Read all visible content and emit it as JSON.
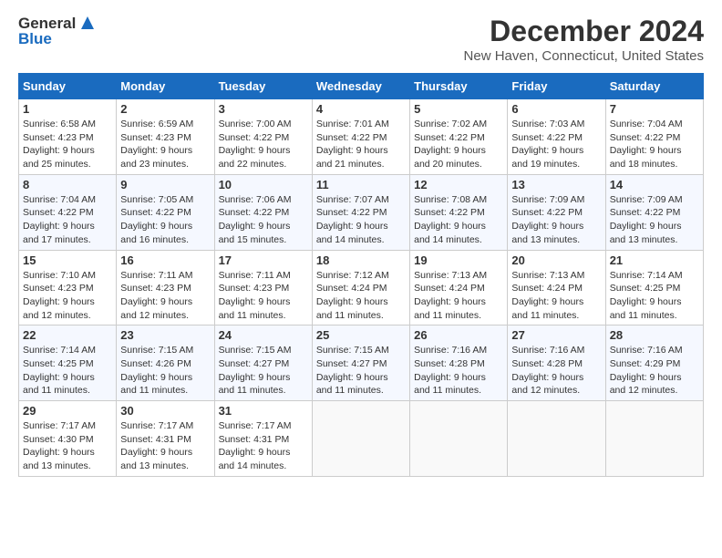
{
  "header": {
    "logo_line1": "General",
    "logo_line2": "Blue",
    "title": "December 2024",
    "subtitle": "New Haven, Connecticut, United States"
  },
  "weekdays": [
    "Sunday",
    "Monday",
    "Tuesday",
    "Wednesday",
    "Thursday",
    "Friday",
    "Saturday"
  ],
  "weeks": [
    [
      {
        "day": "1",
        "sunrise": "6:58 AM",
        "sunset": "4:23 PM",
        "daylight": "9 hours and 25 minutes."
      },
      {
        "day": "2",
        "sunrise": "6:59 AM",
        "sunset": "4:23 PM",
        "daylight": "9 hours and 23 minutes."
      },
      {
        "day": "3",
        "sunrise": "7:00 AM",
        "sunset": "4:22 PM",
        "daylight": "9 hours and 22 minutes."
      },
      {
        "day": "4",
        "sunrise": "7:01 AM",
        "sunset": "4:22 PM",
        "daylight": "9 hours and 21 minutes."
      },
      {
        "day": "5",
        "sunrise": "7:02 AM",
        "sunset": "4:22 PM",
        "daylight": "9 hours and 20 minutes."
      },
      {
        "day": "6",
        "sunrise": "7:03 AM",
        "sunset": "4:22 PM",
        "daylight": "9 hours and 19 minutes."
      },
      {
        "day": "7",
        "sunrise": "7:04 AM",
        "sunset": "4:22 PM",
        "daylight": "9 hours and 18 minutes."
      }
    ],
    [
      {
        "day": "8",
        "sunrise": "7:04 AM",
        "sunset": "4:22 PM",
        "daylight": "9 hours and 17 minutes."
      },
      {
        "day": "9",
        "sunrise": "7:05 AM",
        "sunset": "4:22 PM",
        "daylight": "9 hours and 16 minutes."
      },
      {
        "day": "10",
        "sunrise": "7:06 AM",
        "sunset": "4:22 PM",
        "daylight": "9 hours and 15 minutes."
      },
      {
        "day": "11",
        "sunrise": "7:07 AM",
        "sunset": "4:22 PM",
        "daylight": "9 hours and 14 minutes."
      },
      {
        "day": "12",
        "sunrise": "7:08 AM",
        "sunset": "4:22 PM",
        "daylight": "9 hours and 14 minutes."
      },
      {
        "day": "13",
        "sunrise": "7:09 AM",
        "sunset": "4:22 PM",
        "daylight": "9 hours and 13 minutes."
      },
      {
        "day": "14",
        "sunrise": "7:09 AM",
        "sunset": "4:22 PM",
        "daylight": "9 hours and 13 minutes."
      }
    ],
    [
      {
        "day": "15",
        "sunrise": "7:10 AM",
        "sunset": "4:23 PM",
        "daylight": "9 hours and 12 minutes."
      },
      {
        "day": "16",
        "sunrise": "7:11 AM",
        "sunset": "4:23 PM",
        "daylight": "9 hours and 12 minutes."
      },
      {
        "day": "17",
        "sunrise": "7:11 AM",
        "sunset": "4:23 PM",
        "daylight": "9 hours and 11 minutes."
      },
      {
        "day": "18",
        "sunrise": "7:12 AM",
        "sunset": "4:24 PM",
        "daylight": "9 hours and 11 minutes."
      },
      {
        "day": "19",
        "sunrise": "7:13 AM",
        "sunset": "4:24 PM",
        "daylight": "9 hours and 11 minutes."
      },
      {
        "day": "20",
        "sunrise": "7:13 AM",
        "sunset": "4:24 PM",
        "daylight": "9 hours and 11 minutes."
      },
      {
        "day": "21",
        "sunrise": "7:14 AM",
        "sunset": "4:25 PM",
        "daylight": "9 hours and 11 minutes."
      }
    ],
    [
      {
        "day": "22",
        "sunrise": "7:14 AM",
        "sunset": "4:25 PM",
        "daylight": "9 hours and 11 minutes."
      },
      {
        "day": "23",
        "sunrise": "7:15 AM",
        "sunset": "4:26 PM",
        "daylight": "9 hours and 11 minutes."
      },
      {
        "day": "24",
        "sunrise": "7:15 AM",
        "sunset": "4:27 PM",
        "daylight": "9 hours and 11 minutes."
      },
      {
        "day": "25",
        "sunrise": "7:15 AM",
        "sunset": "4:27 PM",
        "daylight": "9 hours and 11 minutes."
      },
      {
        "day": "26",
        "sunrise": "7:16 AM",
        "sunset": "4:28 PM",
        "daylight": "9 hours and 11 minutes."
      },
      {
        "day": "27",
        "sunrise": "7:16 AM",
        "sunset": "4:28 PM",
        "daylight": "9 hours and 12 minutes."
      },
      {
        "day": "28",
        "sunrise": "7:16 AM",
        "sunset": "4:29 PM",
        "daylight": "9 hours and 12 minutes."
      }
    ],
    [
      {
        "day": "29",
        "sunrise": "7:17 AM",
        "sunset": "4:30 PM",
        "daylight": "9 hours and 13 minutes."
      },
      {
        "day": "30",
        "sunrise": "7:17 AM",
        "sunset": "4:31 PM",
        "daylight": "9 hours and 13 minutes."
      },
      {
        "day": "31",
        "sunrise": "7:17 AM",
        "sunset": "4:31 PM",
        "daylight": "9 hours and 14 minutes."
      },
      null,
      null,
      null,
      null
    ]
  ]
}
